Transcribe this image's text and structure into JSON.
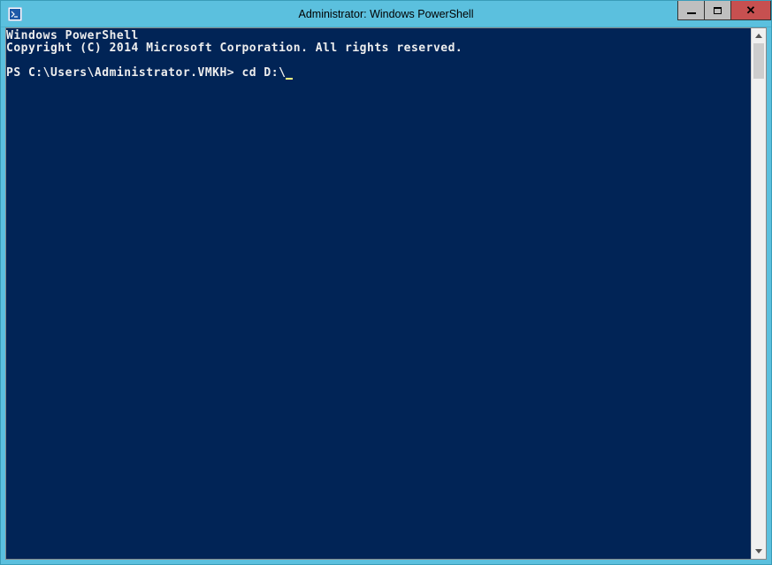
{
  "window": {
    "title": "Administrator: Windows PowerShell"
  },
  "console": {
    "line1": "Windows PowerShell",
    "line2": "Copyright (C) 2014 Microsoft Corporation. All rights reserved.",
    "prompt": "PS C:\\Users\\Administrator.VMKH> ",
    "command": "cd D:\\"
  }
}
